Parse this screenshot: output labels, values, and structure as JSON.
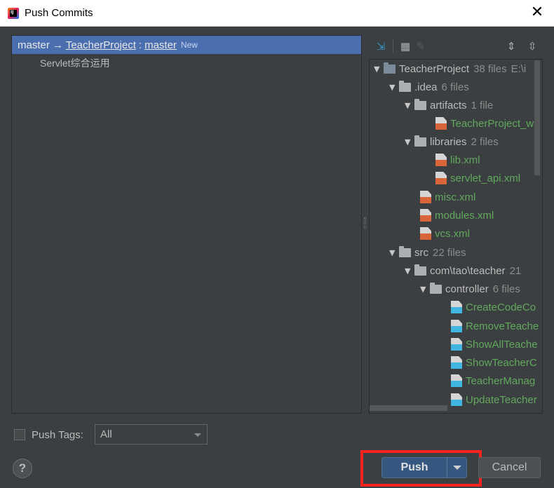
{
  "window": {
    "title": "Push Commits",
    "close": "✕"
  },
  "commits": {
    "branch": {
      "local": "master",
      "arrow": "→",
      "remote": "TeacherProject",
      "sep": ":",
      "remote_branch": "master",
      "tag": "New"
    },
    "items": [
      {
        "message": "Servlet综合运用"
      }
    ]
  },
  "toolbar": {
    "expand_icon": "⇲",
    "group_icon": "▦",
    "edit_icon": "✎",
    "expand_all_icon": "⇕",
    "collapse_all_icon": "⇳"
  },
  "tree": {
    "rows": [
      {
        "name": "TeacherProject",
        "count": "38 files",
        "extra": "E:\\i"
      },
      {
        "name": ".idea",
        "count": "6 files"
      },
      {
        "name": "artifacts",
        "count": "1 file"
      },
      {
        "name": "TeacherProject_w"
      },
      {
        "name": "libraries",
        "count": "2 files"
      },
      {
        "name": "lib.xml"
      },
      {
        "name": "servlet_api.xml"
      },
      {
        "name": "misc.xml"
      },
      {
        "name": "modules.xml"
      },
      {
        "name": "vcs.xml"
      },
      {
        "name": "src",
        "count": "22 files"
      },
      {
        "name": "com\\tao\\teacher",
        "count": "21"
      },
      {
        "name": "controller",
        "count": "6 files"
      },
      {
        "name": "CreateCodeCo"
      },
      {
        "name": "RemoveTeache"
      },
      {
        "name": "ShowAllTeache"
      },
      {
        "name": "ShowTeacherC"
      },
      {
        "name": "TeacherManag"
      },
      {
        "name": "UpdateTeacher"
      }
    ]
  },
  "bottom": {
    "push_tags_label": "Push Tags:",
    "push_tags_mnemonic": "T",
    "tags_value": "All",
    "help": "?",
    "push_label": "Push",
    "cancel_label": "Cancel"
  }
}
